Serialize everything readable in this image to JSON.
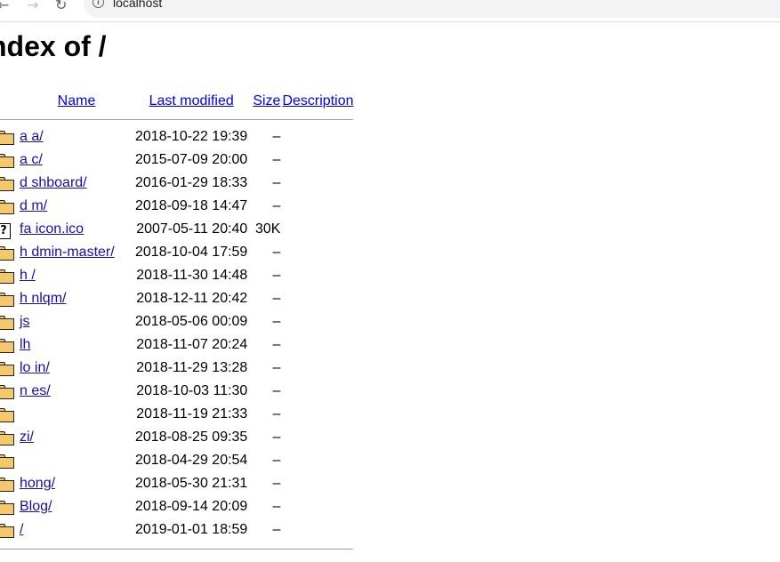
{
  "browser": {
    "back_icon": "arrow-left-icon",
    "forward_icon": "arrow-right-icon",
    "reload_icon": "reload-icon",
    "url": "localhost"
  },
  "page": {
    "title": "ndex of /"
  },
  "table": {
    "headers": {
      "name": "Name",
      "last_modified": "Last modified",
      "size": "Size",
      "description": "Description"
    },
    "rows": [
      {
        "icon": "folder",
        "name": "a  a/",
        "modified": "2018-10-22 19:39",
        "size": "–"
      },
      {
        "icon": "folder",
        "name": "a  c/",
        "modified": "2015-07-09 20:00",
        "size": "–"
      },
      {
        "icon": "folder",
        "name": "d  shboard/",
        "modified": "2016-01-29 18:33",
        "size": "–"
      },
      {
        "icon": "folder",
        "name": "d  m/",
        "modified": "2018-09-18 14:47",
        "size": "–"
      },
      {
        "icon": "unknown",
        "name": "fa icon.ico",
        "modified": "2007-05-11 20:40",
        "size": "30K"
      },
      {
        "icon": "folder",
        "name": "h  dmin-master/",
        "modified": "2018-10-04 17:59",
        "size": "–"
      },
      {
        "icon": "folder",
        "name": "h  /",
        "modified": "2018-11-30 14:48",
        "size": "–"
      },
      {
        "icon": "folder",
        "name": "h  nlqm/",
        "modified": "2018-12-11 20:42",
        "size": "–"
      },
      {
        "icon": "folder",
        "name": "js",
        "modified": "2018-05-06 00:09",
        "size": "–"
      },
      {
        "icon": "folder",
        "name": "lh",
        "modified": "2018-11-07 20:24",
        "size": "–"
      },
      {
        "icon": "folder",
        "name": "lo  in/",
        "modified": "2018-11-29 13:28",
        "size": "–"
      },
      {
        "icon": "folder",
        "name": "n   es/",
        "modified": "2018-10-03 11:30",
        "size": "–"
      },
      {
        "icon": "folder",
        "name": "",
        "modified": "2018-11-19 21:33",
        "size": "–"
      },
      {
        "icon": "folder",
        "name": "  zi/",
        "modified": "2018-08-25 09:35",
        "size": "–"
      },
      {
        "icon": "folder",
        "name": "",
        "modified": "2018-04-29 20:54",
        "size": "–"
      },
      {
        "icon": "folder",
        "name": "   hong/",
        "modified": "2018-05-30 21:31",
        "size": "–"
      },
      {
        "icon": "folder",
        "name": "  Blog/",
        "modified": "2018-09-14 20:09",
        "size": "–"
      },
      {
        "icon": "folder",
        "name": "  /",
        "modified": "2019-01-01 18:59",
        "size": "–"
      }
    ]
  }
}
